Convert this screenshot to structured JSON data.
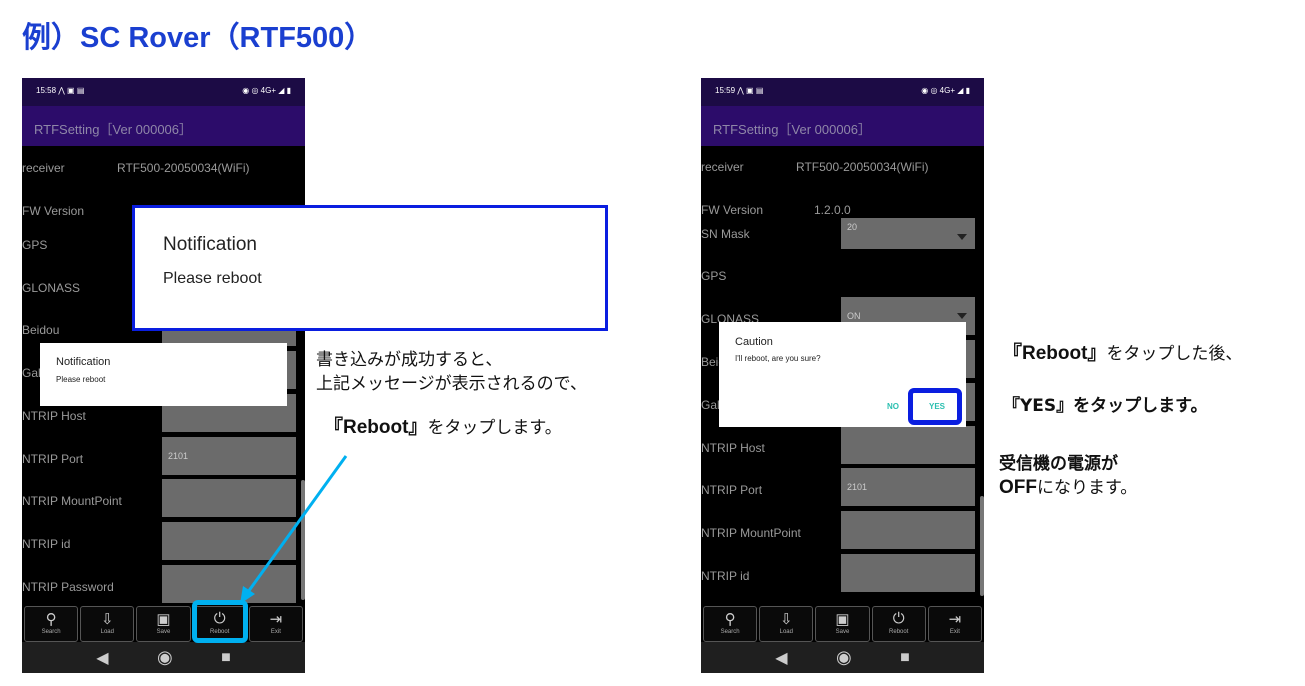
{
  "title": "例）SC Rover（RTF500）",
  "left_phone": {
    "status_time": "15:58",
    "status_icons": "⋀ ▣ ▤",
    "status_right": "◉ ◎ 4G+ ◢ ▮",
    "app_title": "RTFSetting［Ver 000006］",
    "rows": [
      {
        "label": "receiver",
        "value": "RTF500-20050034(WiFi)"
      },
      {
        "label": "FW Version"
      },
      {
        "label": "GPS"
      },
      {
        "label": "GLONASS"
      },
      {
        "label": "Beidou"
      },
      {
        "label": "Galileo"
      },
      {
        "label": "NTRIP Host"
      },
      {
        "label": "NTRIP Port",
        "value": "2101"
      },
      {
        "label": "NTRIP MountPoint"
      },
      {
        "label": "NTRIP id"
      },
      {
        "label": "NTRIP Password"
      }
    ],
    "dialog": {
      "title": "Notification",
      "message": "Please reboot"
    }
  },
  "right_phone": {
    "status_time": "15:59",
    "status_icons": "⋀ ▣ ▤",
    "status_right": "◉ ◎ 4G+ ◢ ▮",
    "app_title": "RTFSetting［Ver 000006］",
    "rows": [
      {
        "label": "receiver",
        "value": "RTF500-20050034(WiFi)"
      },
      {
        "label": "FW Version",
        "value": "1.2.0.0"
      },
      {
        "label": "SN Mask",
        "value": "20"
      },
      {
        "label": "GPS"
      },
      {
        "label": "GLONASS",
        "value": "ON"
      },
      {
        "label": "Beidou"
      },
      {
        "label": "Galileo"
      },
      {
        "label": "NTRIP Host"
      },
      {
        "label": "NTRIP Port",
        "value": "2101"
      },
      {
        "label": "NTRIP MountPoint"
      },
      {
        "label": "NTRIP id"
      }
    ],
    "dialog": {
      "title": "Caution",
      "message": "I'll reboot, are you sure?",
      "no": "NO",
      "yes": "YES"
    }
  },
  "toolbar": [
    "Search",
    "Load",
    "Save",
    "Reboot",
    "Exit"
  ],
  "callout": {
    "title": "Notification",
    "message": "Please reboot"
  },
  "notes_left": {
    "line1": "書き込みが成功すると、",
    "line2": "上記メッセージが表示されるので、",
    "line3_bold": "『Reboot』",
    "line3_rest": "をタップします。"
  },
  "notes_right": {
    "line1_bold": "『Reboot』",
    "line1_rest": "をタップした後、",
    "line2": "『YES』をタップします。",
    "line3": "受信機の電源が",
    "line4_bold": "OFF",
    "line4_rest": "になります。"
  },
  "colors": {
    "highlight_blue": "#0a1ee0",
    "highlight_cyan": "#00b0f0",
    "appbar": "#2c0c6a"
  }
}
